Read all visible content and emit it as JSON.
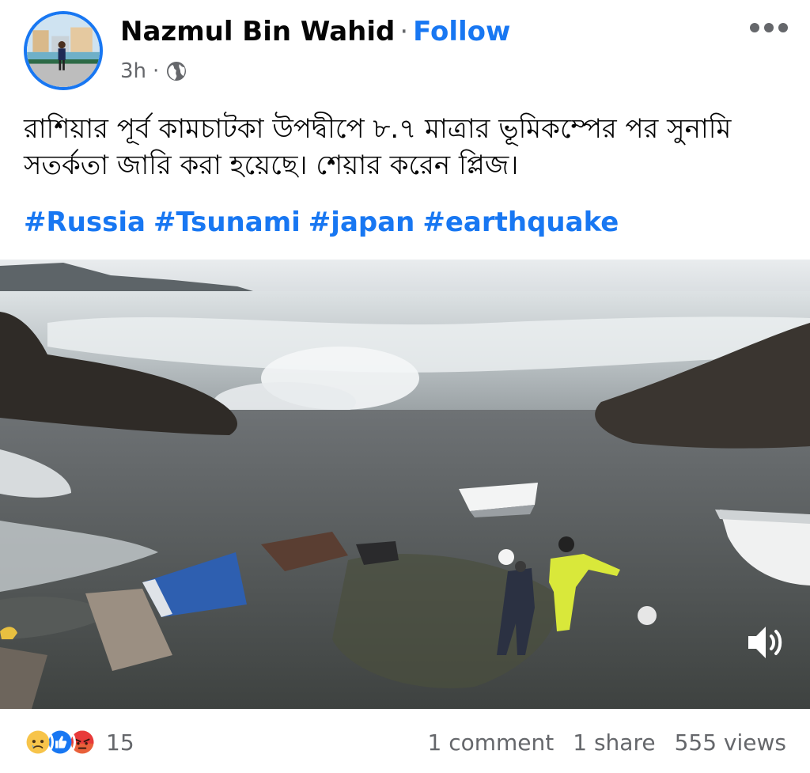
{
  "post": {
    "author": "Nazmul Bin Wahid",
    "follow_label": "Follow",
    "time": "3h",
    "audience_icon": "globe-icon",
    "text": "রাশিয়ার পূর্ব কামচাটকা উপদ্বীপে ৮.৭ মাত্রার ভূমিকম্পের পর সুনামি সতর্কতা জারি করা হয়েছে। শেয়ার করেন প্লিজ।",
    "hashtags": [
      "#Russia",
      "#Tsunami",
      "#japan",
      "#earthquake"
    ]
  },
  "video": {
    "volume_icon": "volume-icon"
  },
  "footer": {
    "reactions": [
      "sad",
      "like",
      "angry"
    ],
    "reaction_count": "15",
    "comments": "1 comment",
    "shares": "1 share",
    "views": "555 views"
  },
  "colors": {
    "accent": "#1877f2",
    "muted": "#65676b"
  }
}
